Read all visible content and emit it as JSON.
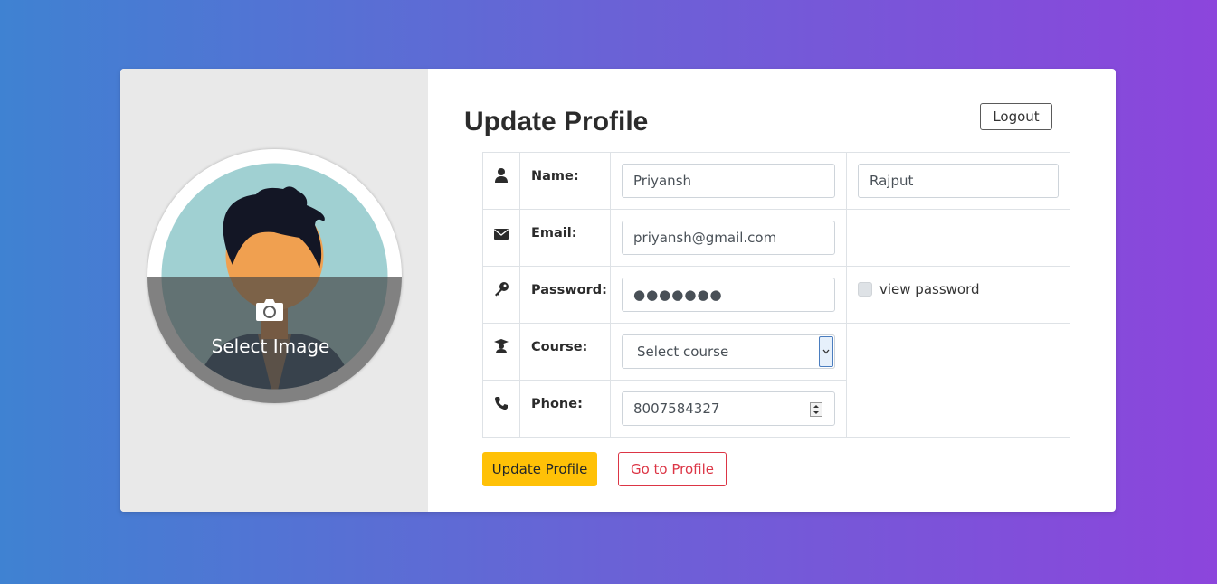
{
  "profile_image": {
    "select_label": "Select Image",
    "camera_icon": "camera-icon",
    "avatar": "user-avatar-illustration"
  },
  "header": {
    "title": "Update Profile",
    "logout_label": "Logout"
  },
  "form": {
    "name": {
      "icon": "user-icon",
      "label": "Name:",
      "first_value": "Priyansh",
      "last_value": "Rajput"
    },
    "email": {
      "icon": "envelope-icon",
      "label": "Email:",
      "value": "priyansh@gmail.com"
    },
    "password": {
      "icon": "key-icon",
      "label": "Password:",
      "masked_value": "●●●●●●●",
      "view_password_label": "view password",
      "view_password_checked": false
    },
    "course": {
      "icon": "graduation-cap-icon",
      "label": "Course:",
      "selected": "Select course"
    },
    "phone": {
      "icon": "phone-icon",
      "label": "Phone:",
      "value": "8007584327"
    }
  },
  "actions": {
    "update_label": "Update Profile",
    "goto_label": "Go to Profile"
  },
  "colors": {
    "gradient_start": "#3f82d2",
    "gradient_end": "#8c45dc",
    "update_button": "#ffc107",
    "goto_button": "#dc3545"
  }
}
